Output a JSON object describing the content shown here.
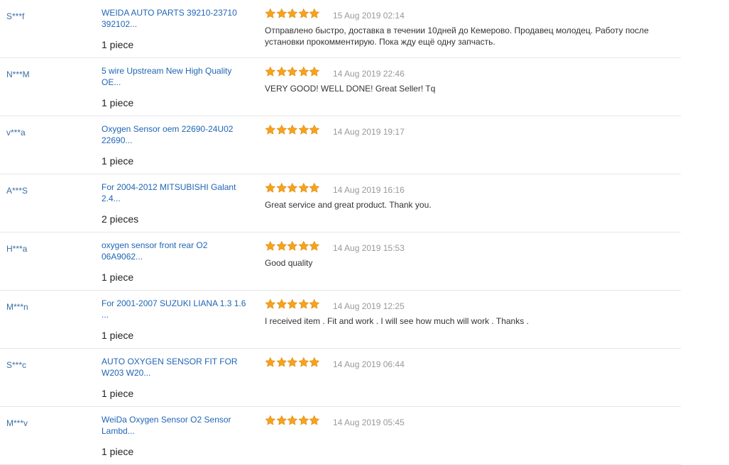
{
  "colors": {
    "buyer": "#3a6ea5",
    "product_link": "#1f65b5",
    "date": "#999999",
    "star": "#f7a21b",
    "divider": "#e6e6e6"
  },
  "icons": {
    "rating": "star-icon"
  },
  "feedback": [
    {
      "buyer": "S***f",
      "product": "WEIDA AUTO PARTS 39210-23710\n392102...",
      "quantity": "1 piece",
      "rating": 5,
      "date": "15 Aug 2019 02:14",
      "review": "Отправлено быстро, доставка в течении 10дней до Кемерово. Продавец молодец. Работу после установки прокомментирую. Пока жду ещё одну запчасть."
    },
    {
      "buyer": "N***M",
      "product": "5 wire Upstream New High Quality\nOE...",
      "quantity": "1 piece",
      "rating": 5,
      "date": "14 Aug 2019 22:46",
      "review": "VERY GOOD! WELL DONE! Great Seller! Tq"
    },
    {
      "buyer": "v***a",
      "product": "Oxygen Sensor oem 22690-24U02\n22690...",
      "quantity": "1 piece",
      "rating": 5,
      "date": "14 Aug 2019 19:17",
      "review": ""
    },
    {
      "buyer": "A***S",
      "product": "For 2004-2012 MITSUBISHI Galant\n2.4...",
      "quantity": "2 pieces",
      "rating": 5,
      "date": "14 Aug 2019 16:16",
      "review": "Great service and great product. Thank you."
    },
    {
      "buyer": "H***a",
      "product": "oxygen sensor front rear O2\n06A9062...",
      "quantity": "1 piece",
      "rating": 5,
      "date": "14 Aug 2019 15:53",
      "review": "Good quality"
    },
    {
      "buyer": "M***n",
      "product": "For 2001-2007 SUZUKI LIANA 1.3 1.6\n...",
      "quantity": "1 piece",
      "rating": 5,
      "date": "14 Aug 2019 12:25",
      "review": "I received item . Fit and work . I will see how much will work . Thanks ."
    },
    {
      "buyer": "S***c",
      "product": "AUTO OXYGEN SENSOR FIT FOR\nW203 W20...",
      "quantity": "1 piece",
      "rating": 5,
      "date": "14 Aug 2019 06:44",
      "review": ""
    },
    {
      "buyer": "M***v",
      "product": "WeiDa Oxygen Sensor O2 Sensor\nLambd...",
      "quantity": "1 piece",
      "rating": 5,
      "date": "14 Aug 2019 05:45",
      "review": ""
    }
  ]
}
